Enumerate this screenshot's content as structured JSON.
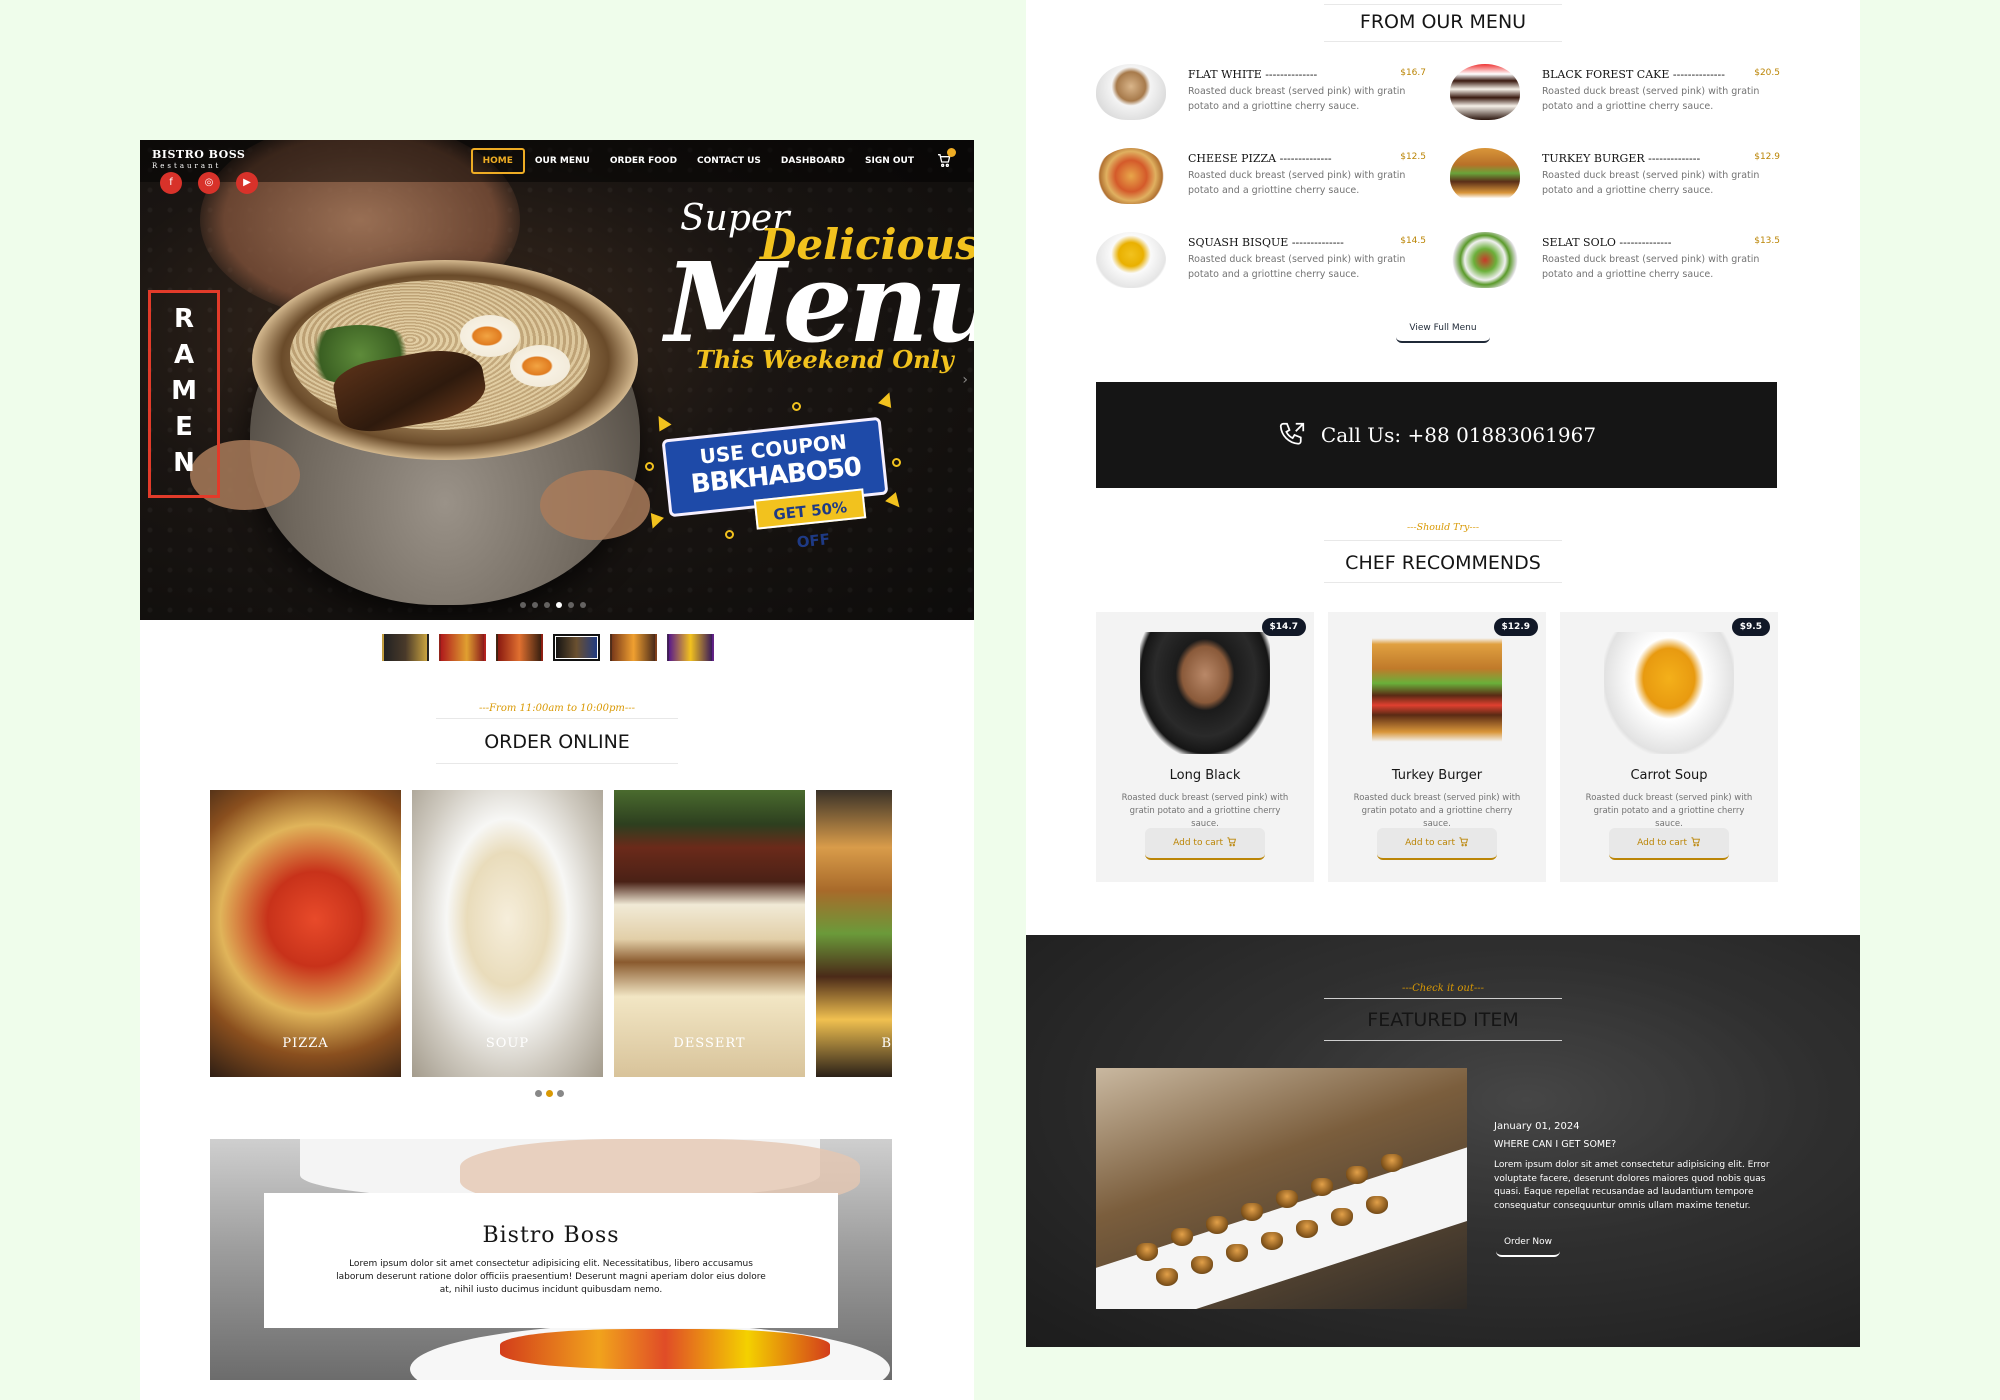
{
  "colors": {
    "background": "#effdeb",
    "gold": "#d99904",
    "price_gold": "#bb8506",
    "dark": "#151515",
    "red": "#e23b2a"
  },
  "nav": {
    "logo_title": "BISTRO BOSS",
    "logo_subtitle": "Restaurant",
    "links": [
      "HOME",
      "OUR MENU",
      "ORDER FOOD",
      "CONTACT US",
      "DASHBOARD",
      "SIGN OUT"
    ],
    "active_link": "HOME",
    "social_icons": [
      "facebook-icon",
      "instagram-icon",
      "youtube-icon"
    ],
    "cart_icon": "cart-icon"
  },
  "hero": {
    "side_label": "RAMEN",
    "super": "Super",
    "delicious": "Delicious",
    "menu": "Menu",
    "weekend": "This Weekend Only",
    "coupon_label": "USE COUPON",
    "coupon_code": "BBKHABO50",
    "discount": "GET 50% OFF",
    "slide_count": 6,
    "active_slide": 4
  },
  "thumbnails": {
    "count": 6,
    "active": 4
  },
  "order_online": {
    "subtitle": "---From 11:00am to 10:00pm---",
    "title": "ORDER ONLINE",
    "categories": [
      "PIZZA",
      "SOUP",
      "DESSERT",
      "B"
    ],
    "dots": 3,
    "active_dot": 2
  },
  "about": {
    "title": "Bistro Boss",
    "text": "Lorem ipsum dolor sit amet consectetur adipisicing elit. Necessitatibus, libero accusamus laborum deserunt ratione dolor officiis praesentium! Deserunt magni aperiam dolor eius dolore at, nihil iusto ducimus incidunt quibusdam nemo."
  },
  "from_menu": {
    "title": "FROM OUR MENU",
    "items": [
      {
        "name": "FLAT WHITE --------------",
        "price": "$16.7",
        "desc": "Roasted duck breast (served pink) with gratin potato and a griottine cherry sauce.",
        "icon": "coffee-icon"
      },
      {
        "name": "BLACK FOREST CAKE --------------",
        "price": "$20.5",
        "desc": "Roasted duck breast (served pink) with gratin potato and a griottine cherry sauce.",
        "icon": "cake-icon"
      },
      {
        "name": "CHEESE PIZZA --------------",
        "price": "$12.5",
        "desc": "Roasted duck breast (served pink) with gratin potato and a griottine cherry sauce.",
        "icon": "pizza-icon"
      },
      {
        "name": "TURKEY BURGER --------------",
        "price": "$12.9",
        "desc": "Roasted duck breast (served pink) with gratin potato and a griottine cherry sauce.",
        "icon": "burger-icon"
      },
      {
        "name": "SQUASH BISQUE --------------",
        "price": "$14.5",
        "desc": "Roasted duck breast (served pink) with gratin potato and a griottine cherry sauce.",
        "icon": "soup-icon"
      },
      {
        "name": "SELAT SOLO --------------",
        "price": "$13.5",
        "desc": "Roasted duck breast (served pink) with gratin potato and a griottine cherry sauce.",
        "icon": "salad-icon"
      }
    ],
    "view_button": "View Full Menu"
  },
  "call": {
    "text": "Call Us: +88 01883061967",
    "icon": "phone-icon"
  },
  "chef": {
    "subtitle": "---Should Try---",
    "title": "CHEF RECOMMENDS",
    "items": [
      {
        "name": "Long Black",
        "price": "$14.7",
        "desc": "Roasted duck breast (served pink) with gratin potato and a griottine cherry sauce.",
        "button": "Add to cart",
        "icon": "coffee-cup-icon"
      },
      {
        "name": "Turkey Burger",
        "price": "$12.9",
        "desc": "Roasted duck breast (served pink) with gratin potato and a griottine cherry sauce.",
        "button": "Add to cart",
        "icon": "burger-icon"
      },
      {
        "name": "Carrot Soup",
        "price": "$9.5",
        "desc": "Roasted duck breast (served pink) with gratin potato and a griottine cherry sauce.",
        "button": "Add to cart",
        "icon": "soup-bowl-icon"
      }
    ]
  },
  "featured": {
    "subtitle": "---Check it out---",
    "title": "FEATURED ITEM",
    "date": "January 01, 2024",
    "question": "WHERE CAN I GET SOME?",
    "text": "Lorem ipsum dolor sit amet consectetur adipisicing elit. Error voluptate facere, deserunt dolores maiores quod nobis quas quasi. Eaque repellat recusandae ad laudantium tempore consequatur consequuntur omnis ullam maxime tenetur.",
    "button": "Order Now"
  }
}
